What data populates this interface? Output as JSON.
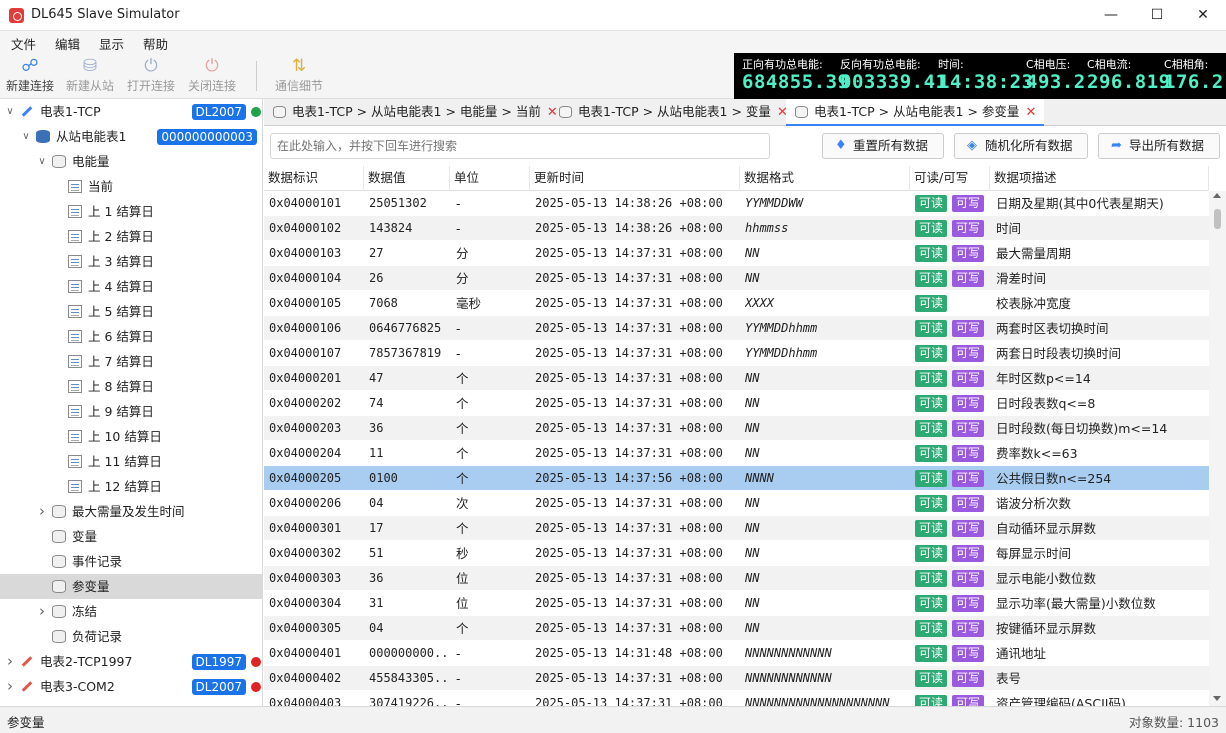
{
  "app": {
    "title": "DL645 Slave Simulator"
  },
  "menu": [
    "文件",
    "编辑",
    "显示",
    "帮助"
  ],
  "toolbar": [
    {
      "label": "新建连接",
      "icon": "new-connection-icon",
      "disabled": false
    },
    {
      "label": "新建从站",
      "icon": "new-slave-icon",
      "disabled": true
    },
    {
      "label": "打开连接",
      "icon": "power-open-icon",
      "disabled": true
    },
    {
      "label": "关闭连接",
      "icon": "power-close-icon",
      "disabled": true
    },
    {
      "label": "通信细节",
      "icon": "comm-details-icon",
      "disabled": true
    }
  ],
  "meters": [
    {
      "label": "正向有功总电能:",
      "value": "684855.39"
    },
    {
      "label": "反向有功总电能:",
      "value": "003339.41"
    },
    {
      "label": "时间:",
      "value": "14:38:23"
    },
    {
      "label": "C相电压:",
      "value": "493.2"
    },
    {
      "label": "C相电流:",
      "value": "296.819"
    },
    {
      "label": "C相相角:",
      "value": "176.2"
    }
  ],
  "tree": [
    {
      "label": "电表1-TCP",
      "badge": "DL2007",
      "status": "green",
      "icon": "conn",
      "level": 0,
      "arrow": "v"
    },
    {
      "label": "从站电能表1",
      "badge": "000000000003",
      "icon": "db",
      "level": 1,
      "arrow": "v"
    },
    {
      "label": "电能量",
      "icon": "stack",
      "level": 2,
      "arrow": "v"
    },
    {
      "label": "当前",
      "icon": "doc",
      "level": 3
    },
    {
      "label": "上 1 结算日",
      "icon": "doc",
      "level": 3
    },
    {
      "label": "上 2 结算日",
      "icon": "doc",
      "level": 3
    },
    {
      "label": "上 3 结算日",
      "icon": "doc",
      "level": 3
    },
    {
      "label": "上 4 结算日",
      "icon": "doc",
      "level": 3
    },
    {
      "label": "上 5 结算日",
      "icon": "doc",
      "level": 3
    },
    {
      "label": "上 6 结算日",
      "icon": "doc",
      "level": 3
    },
    {
      "label": "上 7 结算日",
      "icon": "doc",
      "level": 3
    },
    {
      "label": "上 8 结算日",
      "icon": "doc",
      "level": 3
    },
    {
      "label": "上 9 结算日",
      "icon": "doc",
      "level": 3
    },
    {
      "label": "上 10 结算日",
      "icon": "doc",
      "level": 3
    },
    {
      "label": "上 11 结算日",
      "icon": "doc",
      "level": 3
    },
    {
      "label": "上 12 结算日",
      "icon": "doc",
      "level": 3
    },
    {
      "label": "最大需量及发生时间",
      "icon": "stack",
      "level": 2,
      "arrow": ">"
    },
    {
      "label": "变量",
      "icon": "stack",
      "level": 2
    },
    {
      "label": "事件记录",
      "icon": "stack",
      "level": 2
    },
    {
      "label": "参变量",
      "icon": "stack",
      "level": 2,
      "selected": true
    },
    {
      "label": "冻结",
      "icon": "stack",
      "level": 2,
      "arrow": ">"
    },
    {
      "label": "负荷记录",
      "icon": "stack",
      "level": 2
    },
    {
      "label": "电表2-TCP1997",
      "badge": "DL1997",
      "status": "red",
      "icon": "conn-red",
      "level": 0,
      "arrow": ">"
    },
    {
      "label": "电表3-COM2",
      "badge": "DL2007",
      "status": "red",
      "icon": "conn-red",
      "level": 0,
      "arrow": ">"
    }
  ],
  "tabs": [
    {
      "label": "电表1-TCP > 从站电能表1 > 电能量 > 当前",
      "active": false
    },
    {
      "label": "电表1-TCP > 从站电能表1 > 变量",
      "active": false
    },
    {
      "label": "电表1-TCP > 从站电能表1 > 参变量",
      "active": true
    }
  ],
  "search": {
    "placeholder": "在此处输入，并按下回车进行搜索"
  },
  "actions": [
    {
      "label": "重置所有数据",
      "icon": "eraser-icon"
    },
    {
      "label": "随机化所有数据",
      "icon": "cube-icon"
    },
    {
      "label": "导出所有数据",
      "icon": "share-icon"
    }
  ],
  "columns": [
    "数据标识",
    "数据值",
    "单位",
    "更新时间",
    "数据格式",
    "可读/可写",
    "数据项描述"
  ],
  "badges": {
    "read": "可读",
    "write": "可写"
  },
  "rows": [
    {
      "id": "0x04000101",
      "value": "25051302",
      "unit": "-",
      "time": "2025-05-13 14:38:26 +08:00",
      "fmt": "YYMMDDWW",
      "w": true,
      "desc": "日期及星期(其中0代表星期天)"
    },
    {
      "id": "0x04000102",
      "value": "143824",
      "unit": "-",
      "time": "2025-05-13 14:38:26 +08:00",
      "fmt": "hhmmss",
      "w": true,
      "desc": "时间"
    },
    {
      "id": "0x04000103",
      "value": "27",
      "unit": "分",
      "time": "2025-05-13 14:37:31 +08:00",
      "fmt": "NN",
      "w": true,
      "desc": "最大需量周期"
    },
    {
      "id": "0x04000104",
      "value": "26",
      "unit": "分",
      "time": "2025-05-13 14:37:31 +08:00",
      "fmt": "NN",
      "w": true,
      "desc": "滑差时间"
    },
    {
      "id": "0x04000105",
      "value": "7068",
      "unit": "毫秒",
      "time": "2025-05-13 14:37:31 +08:00",
      "fmt": "XXXX",
      "w": false,
      "desc": "校表脉冲宽度"
    },
    {
      "id": "0x04000106",
      "value": "0646776825",
      "unit": "-",
      "time": "2025-05-13 14:37:31 +08:00",
      "fmt": "YYMMDDhhmm",
      "w": true,
      "desc": "两套时区表切换时间"
    },
    {
      "id": "0x04000107",
      "value": "7857367819",
      "unit": "-",
      "time": "2025-05-13 14:37:31 +08:00",
      "fmt": "YYMMDDhhmm",
      "w": true,
      "desc": "两套日时段表切换时间"
    },
    {
      "id": "0x04000201",
      "value": "47",
      "unit": "个",
      "time": "2025-05-13 14:37:31 +08:00",
      "fmt": "NN",
      "w": true,
      "desc": "年时区数p<=14"
    },
    {
      "id": "0x04000202",
      "value": "74",
      "unit": "个",
      "time": "2025-05-13 14:37:31 +08:00",
      "fmt": "NN",
      "w": true,
      "desc": "日时段表数q<=8"
    },
    {
      "id": "0x04000203",
      "value": "36",
      "unit": "个",
      "time": "2025-05-13 14:37:31 +08:00",
      "fmt": "NN",
      "w": true,
      "desc": "日时段数(每日切换数)m<=14"
    },
    {
      "id": "0x04000204",
      "value": "11",
      "unit": "个",
      "time": "2025-05-13 14:37:31 +08:00",
      "fmt": "NN",
      "w": true,
      "desc": "费率数k<=63"
    },
    {
      "id": "0x04000205",
      "value": "0100",
      "unit": "个",
      "time": "2025-05-13 14:37:56 +08:00",
      "fmt": "NNNN",
      "w": true,
      "desc": "公共假日数n<=254",
      "selected": true
    },
    {
      "id": "0x04000206",
      "value": "04",
      "unit": "次",
      "time": "2025-05-13 14:37:31 +08:00",
      "fmt": "NN",
      "w": true,
      "desc": "谐波分析次数"
    },
    {
      "id": "0x04000301",
      "value": "17",
      "unit": "个",
      "time": "2025-05-13 14:37:31 +08:00",
      "fmt": "NN",
      "w": true,
      "desc": "自动循环显示屏数"
    },
    {
      "id": "0x04000302",
      "value": "51",
      "unit": "秒",
      "time": "2025-05-13 14:37:31 +08:00",
      "fmt": "NN",
      "w": true,
      "desc": "每屏显示时间"
    },
    {
      "id": "0x04000303",
      "value": "36",
      "unit": "位",
      "time": "2025-05-13 14:37:31 +08:00",
      "fmt": "NN",
      "w": true,
      "desc": "显示电能小数位数"
    },
    {
      "id": "0x04000304",
      "value": "31",
      "unit": "位",
      "time": "2025-05-13 14:37:31 +08:00",
      "fmt": "NN",
      "w": true,
      "desc": "显示功率(最大需量)小数位数"
    },
    {
      "id": "0x04000305",
      "value": "04",
      "unit": "个",
      "time": "2025-05-13 14:37:31 +08:00",
      "fmt": "NN",
      "w": true,
      "desc": "按键循环显示屏数"
    },
    {
      "id": "0x04000401",
      "value": "000000000...",
      "unit": "-",
      "time": "2025-05-13 14:31:48 +08:00",
      "fmt": "NNNNNNNNNNNN",
      "w": true,
      "desc": "通讯地址"
    },
    {
      "id": "0x04000402",
      "value": "455843305...",
      "unit": "-",
      "time": "2025-05-13 14:37:31 +08:00",
      "fmt": "NNNNNNNNNNNN",
      "w": true,
      "desc": "表号"
    },
    {
      "id": "0x04000403",
      "value": "307419226...",
      "unit": "-",
      "time": "2025-05-13 14:37:31 +08:00",
      "fmt": "NNNNNNNNNNNNNNNNNNNN",
      "w": true,
      "desc": "资产管理编码(ASCII码)"
    }
  ],
  "status": {
    "left": "参变量",
    "right": "对象数量: 1103"
  },
  "colors": {
    "read_badge": "#2daa73",
    "write_badge": "#9b59e0",
    "lcd_text": "#4ef1c7",
    "accent": "#1a73e8"
  }
}
